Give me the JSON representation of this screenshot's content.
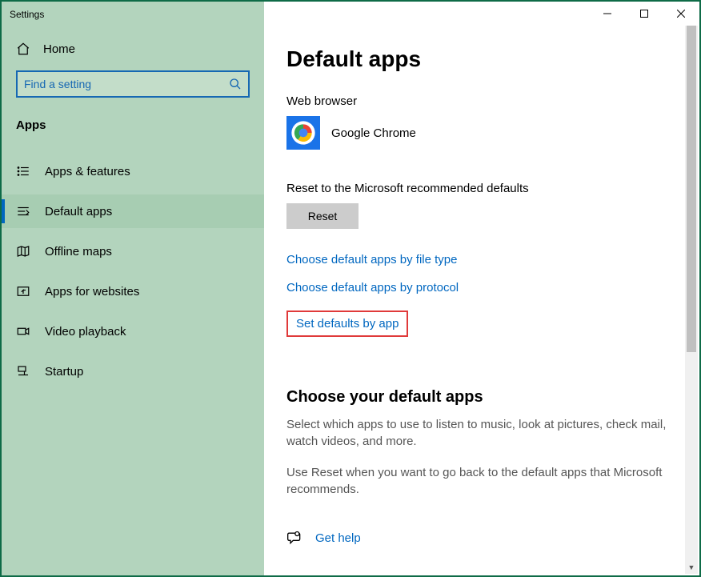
{
  "window": {
    "title": "Settings"
  },
  "sidebar": {
    "home": "Home",
    "search_placeholder": "Find a setting",
    "category": "Apps",
    "items": [
      {
        "label": "Apps & features",
        "selected": false
      },
      {
        "label": "Default apps",
        "selected": true
      },
      {
        "label": "Offline maps",
        "selected": false
      },
      {
        "label": "Apps for websites",
        "selected": false
      },
      {
        "label": "Video playback",
        "selected": false
      },
      {
        "label": "Startup",
        "selected": false
      }
    ]
  },
  "main": {
    "title": "Default apps",
    "web_browser_label": "Web browser",
    "web_browser_app": "Google Chrome",
    "reset_label": "Reset to the Microsoft recommended defaults",
    "reset_button": "Reset",
    "link_file_type": "Choose default apps by file type",
    "link_protocol": "Choose default apps by protocol",
    "link_by_app": "Set defaults by app",
    "choose_heading": "Choose your default apps",
    "choose_desc1": "Select which apps to use to listen to music, look at pictures, check mail, watch videos, and more.",
    "choose_desc2": "Use Reset when you want to go back to the default apps that Microsoft recommends.",
    "get_help": "Get help"
  },
  "highlight": {
    "target": "link_by_app",
    "color": "#e03a3a"
  }
}
